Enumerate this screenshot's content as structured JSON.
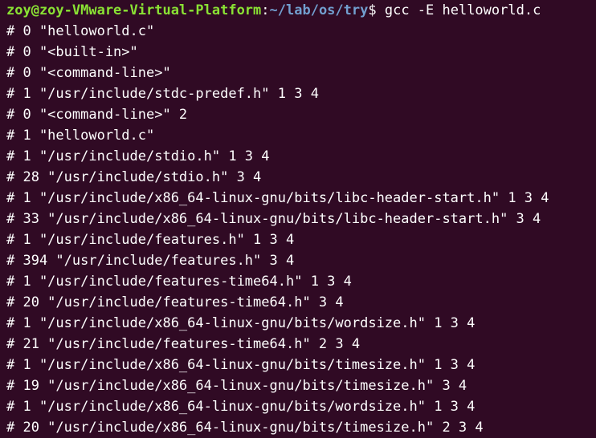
{
  "prompt": {
    "user_host": "zoy@zoy-VMware-Virtual-Platform",
    "separator": ":",
    "cwd": "~/lab/os/try",
    "symbol": "$ ",
    "command": "gcc -E helloworld.c"
  },
  "output_lines": [
    "# 0 \"helloworld.c\"",
    "# 0 \"<built-in>\"",
    "# 0 \"<command-line>\"",
    "# 1 \"/usr/include/stdc-predef.h\" 1 3 4",
    "# 0 \"<command-line>\" 2",
    "# 1 \"helloworld.c\"",
    "# 1 \"/usr/include/stdio.h\" 1 3 4",
    "# 28 \"/usr/include/stdio.h\" 3 4",
    "# 1 \"/usr/include/x86_64-linux-gnu/bits/libc-header-start.h\" 1 3 4",
    "# 33 \"/usr/include/x86_64-linux-gnu/bits/libc-header-start.h\" 3 4",
    "# 1 \"/usr/include/features.h\" 1 3 4",
    "# 394 \"/usr/include/features.h\" 3 4",
    "# 1 \"/usr/include/features-time64.h\" 1 3 4",
    "# 20 \"/usr/include/features-time64.h\" 3 4",
    "# 1 \"/usr/include/x86_64-linux-gnu/bits/wordsize.h\" 1 3 4",
    "# 21 \"/usr/include/features-time64.h\" 2 3 4",
    "# 1 \"/usr/include/x86_64-linux-gnu/bits/timesize.h\" 1 3 4",
    "# 19 \"/usr/include/x86_64-linux-gnu/bits/timesize.h\" 3 4",
    "# 1 \"/usr/include/x86_64-linux-gnu/bits/wordsize.h\" 1 3 4",
    "# 20 \"/usr/include/x86_64-linux-gnu/bits/timesize.h\" 2 3 4"
  ],
  "colors": {
    "background": "#300a24",
    "user_host": "#8ae234",
    "path": "#729fcf",
    "text": "#ffffff"
  }
}
